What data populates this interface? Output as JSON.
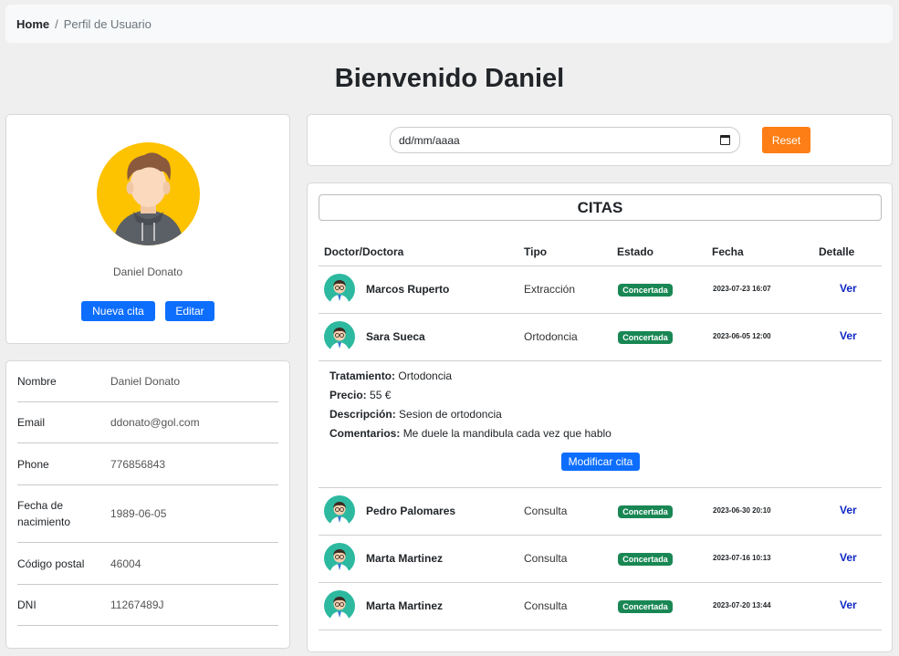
{
  "breadcrumb": {
    "home": "Home",
    "separator": "/",
    "current": "Perfil de Usuario"
  },
  "page_title": "Bienvenido Daniel",
  "profile": {
    "name": "Daniel Donato",
    "new_appointment_label": "Nueva cita",
    "edit_label": "Editar"
  },
  "info": [
    {
      "label": "Nombre",
      "value": "Daniel Donato"
    },
    {
      "label": "Email",
      "value": "ddonato@gol.com"
    },
    {
      "label": "Phone",
      "value": "776856843"
    },
    {
      "label": "Fecha de nacimiento",
      "value": "1989-06-05"
    },
    {
      "label": "Código postal",
      "value": "46004"
    },
    {
      "label": "DNI",
      "value": "11267489J"
    }
  ],
  "filter": {
    "date_placeholder": "dd/mm/aaaa",
    "reset_label": "Reset"
  },
  "citas": {
    "title": "CITAS",
    "headers": {
      "doctor": "Doctor/Doctora",
      "tipo": "Tipo",
      "estado": "Estado",
      "fecha": "Fecha",
      "detalle": "Detalle"
    },
    "rows": [
      {
        "doctor": "Marcos Ruperto",
        "tipo": "Extracción",
        "estado": "Concertada",
        "fecha": "2023-07-23 16:07",
        "link": "Ver"
      },
      {
        "doctor": "Sara Sueca",
        "tipo": "Ortodoncia",
        "estado": "Concertada",
        "fecha": "2023-06-05 12:00",
        "link": "Ver"
      },
      {
        "doctor": "Pedro Palomares",
        "tipo": "Consulta",
        "estado": "Concertada",
        "fecha": "2023-06-30 20:10",
        "link": "Ver"
      },
      {
        "doctor": "Marta Martinez",
        "tipo": "Consulta",
        "estado": "Concertada",
        "fecha": "2023-07-16 10:13",
        "link": "Ver"
      },
      {
        "doctor": "Marta Martinez",
        "tipo": "Consulta",
        "estado": "Concertada",
        "fecha": "2023-07-20 13:44",
        "link": "Ver"
      }
    ],
    "detail": {
      "tratamiento_label": "Tratamiento:",
      "tratamiento": "Ortodoncia",
      "precio_label": "Precio:",
      "precio": "55 €",
      "descripcion_label": "Descripción:",
      "descripcion": "Sesion de ortodoncia",
      "comentarios_label": "Comentarios:",
      "comentarios": "Me duele la mandibula cada vez que hablo",
      "modify_label": "Modificar cita"
    }
  },
  "colors": {
    "primary": "#0d6efd",
    "reset": "#fd7e14",
    "badge": "#198754",
    "avatar_bg": "#fdc200",
    "doctor_avatar_bg": "#2db9a0"
  },
  "icons": {
    "user_avatar": "user-avatar-icon",
    "doctor_avatar": "doctor-avatar-icon",
    "calendar": "calendar-icon"
  }
}
